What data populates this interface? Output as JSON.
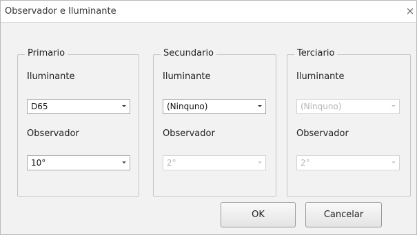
{
  "window": {
    "title": "Observador e Iluminante",
    "close_glyph": "×"
  },
  "groups": [
    {
      "legend": "Primario",
      "illuminant_label": "Iluminante",
      "illuminant_value": "D65",
      "observer_label": "Observador",
      "observer_value": "10°",
      "enabled": true
    },
    {
      "legend": "Secundario",
      "illuminant_label": "Iluminante",
      "illuminant_value": "(Ninquno)",
      "observer_label": "Observador",
      "observer_value": "2°",
      "enabled": true
    },
    {
      "legend": "Terciario",
      "illuminant_label": "Iluminante",
      "illuminant_value": "(Ninquno)",
      "observer_label": "Observador",
      "observer_value": "2°",
      "enabled": false
    }
  ],
  "buttons": {
    "ok_label": "OK",
    "cancel_label": "Cancelar"
  },
  "icons": {
    "close": "close-icon",
    "dropdown": "chevron-down-icon"
  },
  "colors": {
    "dialog_background": "#f2f2f2",
    "titlebar_background": "#ffffff",
    "disabled_text": "#b4b4b4"
  }
}
